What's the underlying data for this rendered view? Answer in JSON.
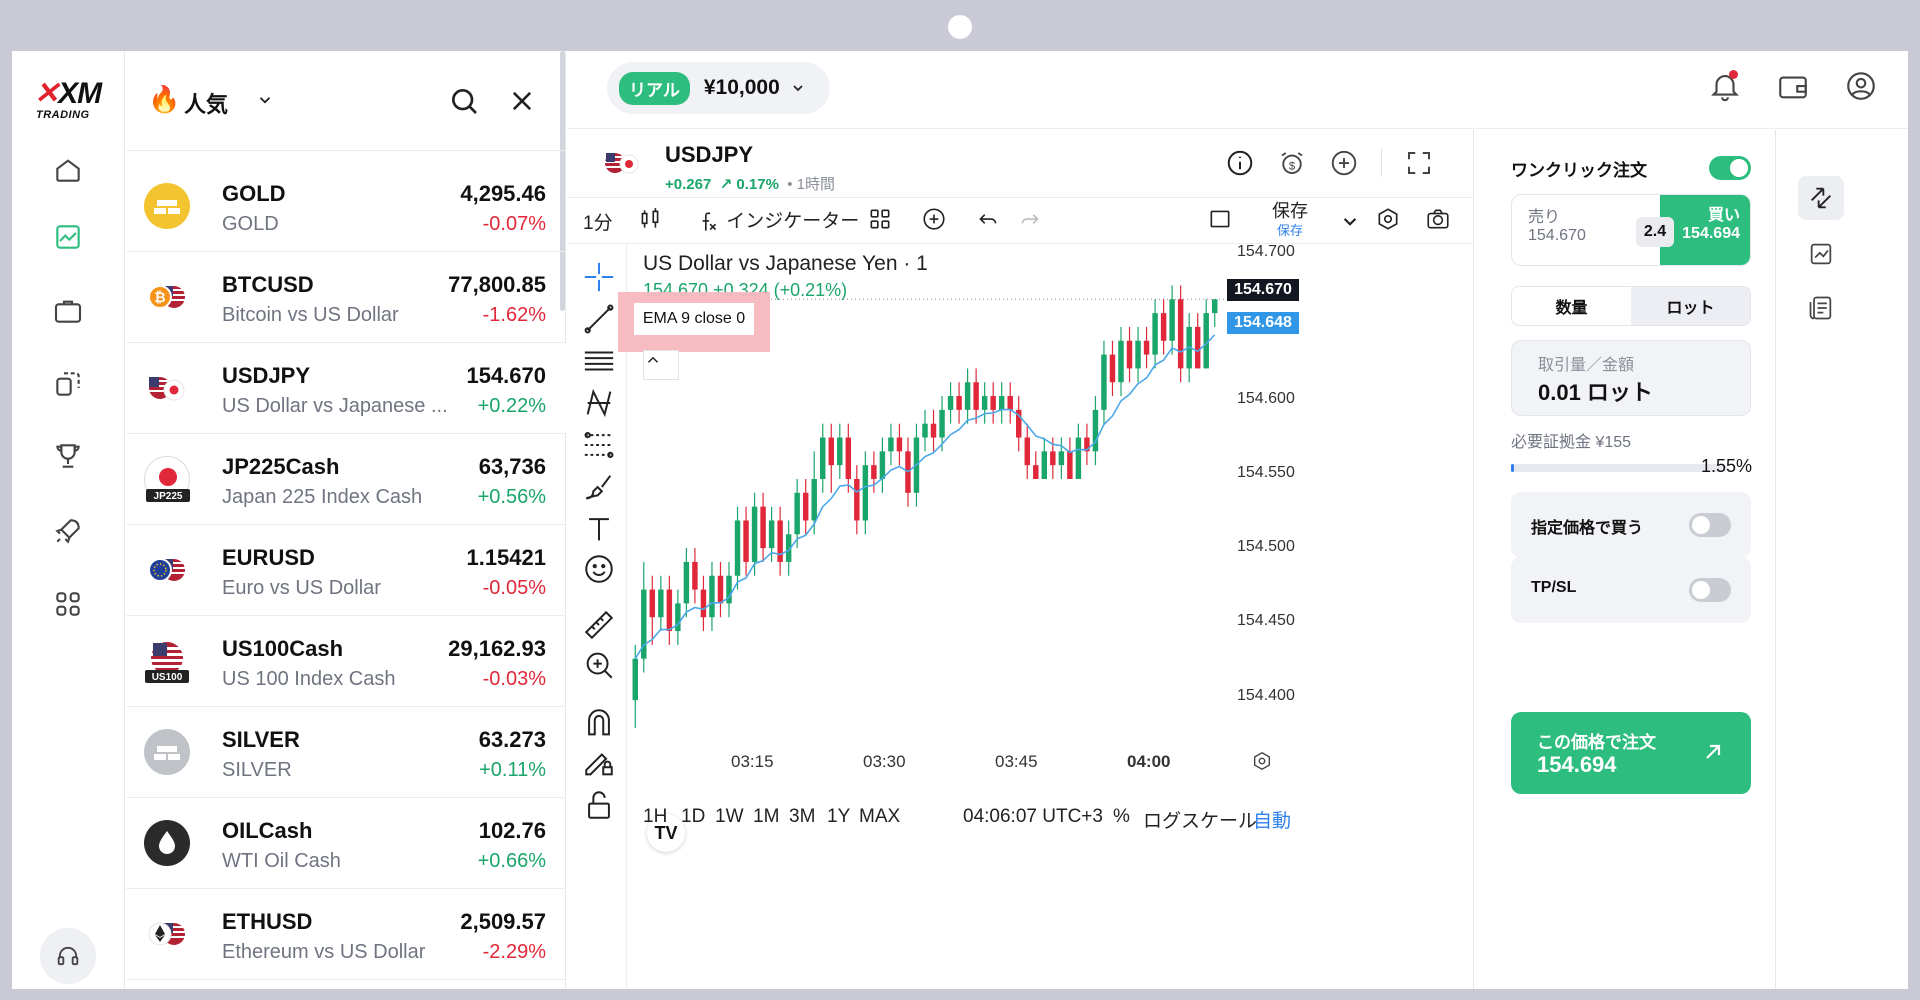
{
  "brand": {
    "logo_text": "XM",
    "logo_sub": "TRADING"
  },
  "watchlist": {
    "title": "人気",
    "items": [
      {
        "symbol": "GOLD",
        "desc": "GOLD",
        "price": "4,295.46",
        "change": "-0.07%",
        "dir": "down",
        "icon": "gold-icon"
      },
      {
        "symbol": "BTCUSD",
        "desc": "Bitcoin vs US Dollar",
        "price": "77,800.85",
        "change": "-1.62%",
        "dir": "down",
        "icon": "btc-usd-flag-icon"
      },
      {
        "symbol": "USDJPY",
        "desc": "US Dollar vs Japanese ...",
        "price": "154.670",
        "change": "+0.22%",
        "dir": "up",
        "icon": "usd-jpy-flag-icon"
      },
      {
        "symbol": "JP225Cash",
        "desc": "Japan 225 Index Cash",
        "price": "63,736",
        "change": "+0.56%",
        "dir": "up",
        "icon": "japan-flag-icon",
        "badge": "JP225"
      },
      {
        "symbol": "EURUSD",
        "desc": "Euro vs US Dollar",
        "price": "1.15421",
        "change": "-0.05%",
        "dir": "down",
        "icon": "eur-usd-flag-icon"
      },
      {
        "symbol": "US100Cash",
        "desc": "US 100 Index Cash",
        "price": "29,162.93",
        "change": "-0.03%",
        "dir": "down",
        "icon": "us-flag-icon",
        "badge": "US100"
      },
      {
        "symbol": "SILVER",
        "desc": "SILVER",
        "price": "63.273",
        "change": "+0.11%",
        "dir": "up",
        "icon": "silver-icon"
      },
      {
        "symbol": "OILCash",
        "desc": "WTI Oil Cash",
        "price": "102.76",
        "change": "+0.66%",
        "dir": "up",
        "icon": "oil-drop-icon"
      },
      {
        "symbol": "ETHUSD",
        "desc": "Ethereum vs US Dollar",
        "price": "2,509.57",
        "change": "-2.29%",
        "dir": "down",
        "icon": "eth-usd-flag-icon"
      }
    ]
  },
  "account": {
    "type": "リアル",
    "balance": "¥10,000"
  },
  "symbol_header": {
    "name": "USDJPY",
    "change": "+0.267",
    "change_pct": "↗ 0.17%",
    "timeframe": "• 1時間"
  },
  "toolbar": {
    "interval": "1分",
    "indicators": "インジケーター",
    "save": "保存",
    "save_sub": "保存"
  },
  "chart_legend": {
    "title": "US Dollar vs Japanese Yen · 1",
    "ohlc": "154.670 +0.324 (+0.21%)",
    "ema": "EMA 9 close 0"
  },
  "chart_data": {
    "type": "candlestick",
    "symbol": "USDJPY",
    "y_ticks": [
      "154.700",
      "154.600",
      "154.550",
      "154.500",
      "154.450",
      "154.400"
    ],
    "x_ticks": [
      "03:15",
      "03:30",
      "03:45",
      "04:00"
    ],
    "ylim": [
      154.37,
      154.71
    ],
    "last_price": "154.670",
    "ema_price": "154.648",
    "candles": [
      [
        154.38,
        154.41,
        154.36,
        154.42
      ],
      [
        154.41,
        154.46,
        154.4,
        154.48
      ],
      [
        154.46,
        154.44,
        154.42,
        154.47
      ],
      [
        154.44,
        154.46,
        154.43,
        154.47
      ],
      [
        154.46,
        154.43,
        154.42,
        154.47
      ],
      [
        154.43,
        154.45,
        154.42,
        154.46
      ],
      [
        154.45,
        154.48,
        154.44,
        154.49
      ],
      [
        154.48,
        154.46,
        154.45,
        154.49
      ],
      [
        154.46,
        154.44,
        154.43,
        154.47
      ],
      [
        154.44,
        154.47,
        154.43,
        154.48
      ],
      [
        154.47,
        154.45,
        154.44,
        154.48
      ],
      [
        154.45,
        154.47,
        154.44,
        154.48
      ],
      [
        154.47,
        154.51,
        154.46,
        154.52
      ],
      [
        154.51,
        154.48,
        154.47,
        154.52
      ],
      [
        154.48,
        154.52,
        154.47,
        154.53
      ],
      [
        154.52,
        154.49,
        154.48,
        154.53
      ],
      [
        154.49,
        154.51,
        154.48,
        154.52
      ],
      [
        154.51,
        154.48,
        154.47,
        154.52
      ],
      [
        154.48,
        154.5,
        154.47,
        154.51
      ],
      [
        154.5,
        154.53,
        154.49,
        154.54
      ],
      [
        154.53,
        154.51,
        154.5,
        154.54
      ],
      [
        154.51,
        154.54,
        154.5,
        154.56
      ],
      [
        154.54,
        154.57,
        154.53,
        154.58
      ],
      [
        154.57,
        154.55,
        154.53,
        154.58
      ],
      [
        154.55,
        154.57,
        154.54,
        154.58
      ],
      [
        154.57,
        154.54,
        154.53,
        154.58
      ],
      [
        154.54,
        154.51,
        154.5,
        154.55
      ],
      [
        154.51,
        154.55,
        154.5,
        154.56
      ],
      [
        154.55,
        154.54,
        154.53,
        154.56
      ],
      [
        154.54,
        154.56,
        154.53,
        154.57
      ],
      [
        154.56,
        154.57,
        154.55,
        154.58
      ],
      [
        154.57,
        154.56,
        154.55,
        154.58
      ],
      [
        154.56,
        154.53,
        154.52,
        154.57
      ],
      [
        154.53,
        154.57,
        154.52,
        154.58
      ],
      [
        154.57,
        154.58,
        154.56,
        154.59
      ],
      [
        154.58,
        154.57,
        154.56,
        154.59
      ],
      [
        154.57,
        154.59,
        154.56,
        154.6
      ],
      [
        154.59,
        154.6,
        154.58,
        154.61
      ],
      [
        154.6,
        154.59,
        154.58,
        154.61
      ],
      [
        154.59,
        154.61,
        154.58,
        154.62
      ],
      [
        154.61,
        154.59,
        154.58,
        154.62
      ],
      [
        154.59,
        154.6,
        154.58,
        154.61
      ],
      [
        154.6,
        154.59,
        154.58,
        154.61
      ],
      [
        154.59,
        154.6,
        154.58,
        154.61
      ],
      [
        154.6,
        154.59,
        154.58,
        154.61
      ],
      [
        154.59,
        154.57,
        154.56,
        154.6
      ],
      [
        154.57,
        154.55,
        154.54,
        154.58
      ],
      [
        154.55,
        154.54,
        154.54,
        154.56
      ],
      [
        154.54,
        154.56,
        154.54,
        154.57
      ],
      [
        154.56,
        154.55,
        154.54,
        154.57
      ],
      [
        154.55,
        154.56,
        154.54,
        154.57
      ],
      [
        154.56,
        154.54,
        154.54,
        154.57
      ],
      [
        154.54,
        154.57,
        154.54,
        154.58
      ],
      [
        154.57,
        154.56,
        154.55,
        154.58
      ],
      [
        154.56,
        154.59,
        154.55,
        154.6
      ],
      [
        154.59,
        154.63,
        154.58,
        154.64
      ],
      [
        154.63,
        154.61,
        154.6,
        154.64
      ],
      [
        154.61,
        154.64,
        154.6,
        154.65
      ],
      [
        154.64,
        154.62,
        154.61,
        154.65
      ],
      [
        154.62,
        154.64,
        154.61,
        154.65
      ],
      [
        154.64,
        154.63,
        154.62,
        154.65
      ],
      [
        154.63,
        154.66,
        154.62,
        154.67
      ],
      [
        154.66,
        154.64,
        154.63,
        154.67
      ],
      [
        154.64,
        154.67,
        154.63,
        154.68
      ],
      [
        154.67,
        154.62,
        154.61,
        154.68
      ],
      [
        154.62,
        154.65,
        154.61,
        154.66
      ],
      [
        154.65,
        154.62,
        154.62,
        154.66
      ],
      [
        154.62,
        154.66,
        154.62,
        154.67
      ],
      [
        154.66,
        154.67,
        154.65,
        154.67
      ]
    ]
  },
  "bottom_bar": {
    "ranges": [
      "1H",
      "1D",
      "1W",
      "1M",
      "3M",
      "1Y",
      "MAX"
    ],
    "time": "04:06:07 UTC+3",
    "percent": "%",
    "log": "ログスケール",
    "auto": "自動"
  },
  "order": {
    "one_click_label": "ワンクリック注文",
    "one_click_on": true,
    "sell_label": "売り",
    "sell_price": "154.670",
    "spread": "2.4",
    "buy_label": "買い",
    "buy_price": "154.694",
    "tab_qty": "数量",
    "tab_lot": "ロット",
    "volume_label": "取引量／金額",
    "volume_value": "0.01 ロット",
    "margin_label": "必要証拠金 ¥155",
    "margin_pct": "1.55%",
    "margin_fraction": 0.0155,
    "limit_label": "指定価格で買う",
    "tpsl_label": "TP/SL",
    "cta_line1": "この価格で注文",
    "cta_line2": "154.694"
  },
  "colors": {
    "accent_green": "#2dbd7f",
    "up": "#1aa56a",
    "down": "#e0283a",
    "ema": "#4ba8e8"
  }
}
